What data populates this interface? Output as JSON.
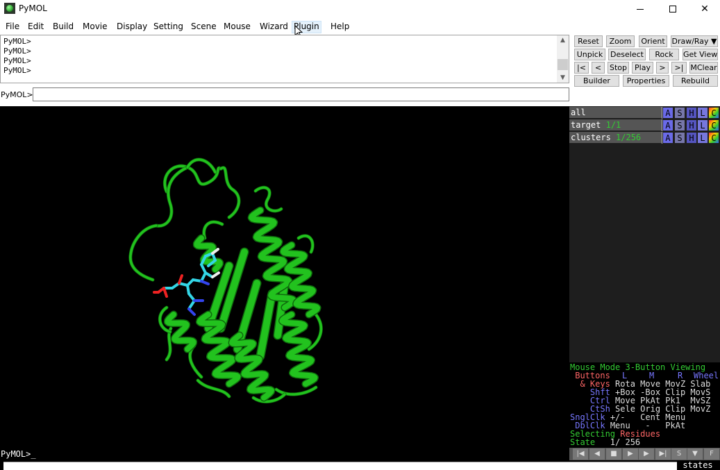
{
  "window": {
    "title": "PyMOL"
  },
  "menu": [
    "File",
    "Edit",
    "Build",
    "Movie",
    "Display",
    "Setting",
    "Scene",
    "Mouse",
    "Wizard",
    "Plugin",
    "Help"
  ],
  "output": {
    "lines": [
      "PyMOL>",
      "PyMOL>",
      "PyMOL>",
      "PyMOL>"
    ]
  },
  "command": {
    "label": "PyMOL>",
    "value": ""
  },
  "buttons": {
    "reset": "Reset",
    "zoom": "Zoom",
    "orient": "Orient",
    "draw_ray": "Draw/Ray ▼",
    "unpick": "Unpick",
    "deselect": "Deselect",
    "rock": "Rock",
    "get_view": "Get View",
    "first": "|<",
    "prev": "<",
    "stop": "Stop",
    "play": "Play",
    "next": ">",
    "last": ">|",
    "mclear": "MClear",
    "builder": "Builder",
    "properties": "Properties",
    "rebuild": "Rebuild"
  },
  "objects": [
    {
      "name": "all",
      "count": ""
    },
    {
      "name": "target",
      "count": "1/1"
    },
    {
      "name": "clusters",
      "count": "1/256"
    }
  ],
  "object_buttons": [
    "A",
    "S",
    "H",
    "L",
    "C"
  ],
  "mouse_info": {
    "mode_line": "Mouse Mode 3-Button Viewing",
    "buttons_label": " Buttons",
    "btn_l": "L",
    "btn_m": "M",
    "btn_r": "R",
    "btn_wheel": "Wheel",
    "keys_label": "  & Keys",
    "keys_values": "Rota Move MovZ Slab",
    "shft_label": "    Shft",
    "shft_values": "+Box -Box Clip MovS",
    "ctrl_label": "    Ctrl",
    "ctrl_values": "Move PkAt Pk1  MvSZ",
    "ctsh_label": "    CtSh",
    "ctsh_values": "Sele Orig Clip MovZ",
    "sngl_label": "SnglClk",
    "sngl_values": "+/-   Cent Menu",
    "dbl_label": " DblClk",
    "dbl_values": "Menu   -   PkAt",
    "selecting_label": "Selecting",
    "selecting_value": "Residues",
    "state_label": "State",
    "state_value": "   1/ 256"
  },
  "bottom_command": "PyMOL>_",
  "states_label": "states",
  "colors": {
    "protein": "#22c21e",
    "ligand_carbon": "#33d6e6",
    "oxygen": "#ee2222",
    "nitrogen": "#3344ee",
    "hydrogen": "#eeeeee"
  }
}
